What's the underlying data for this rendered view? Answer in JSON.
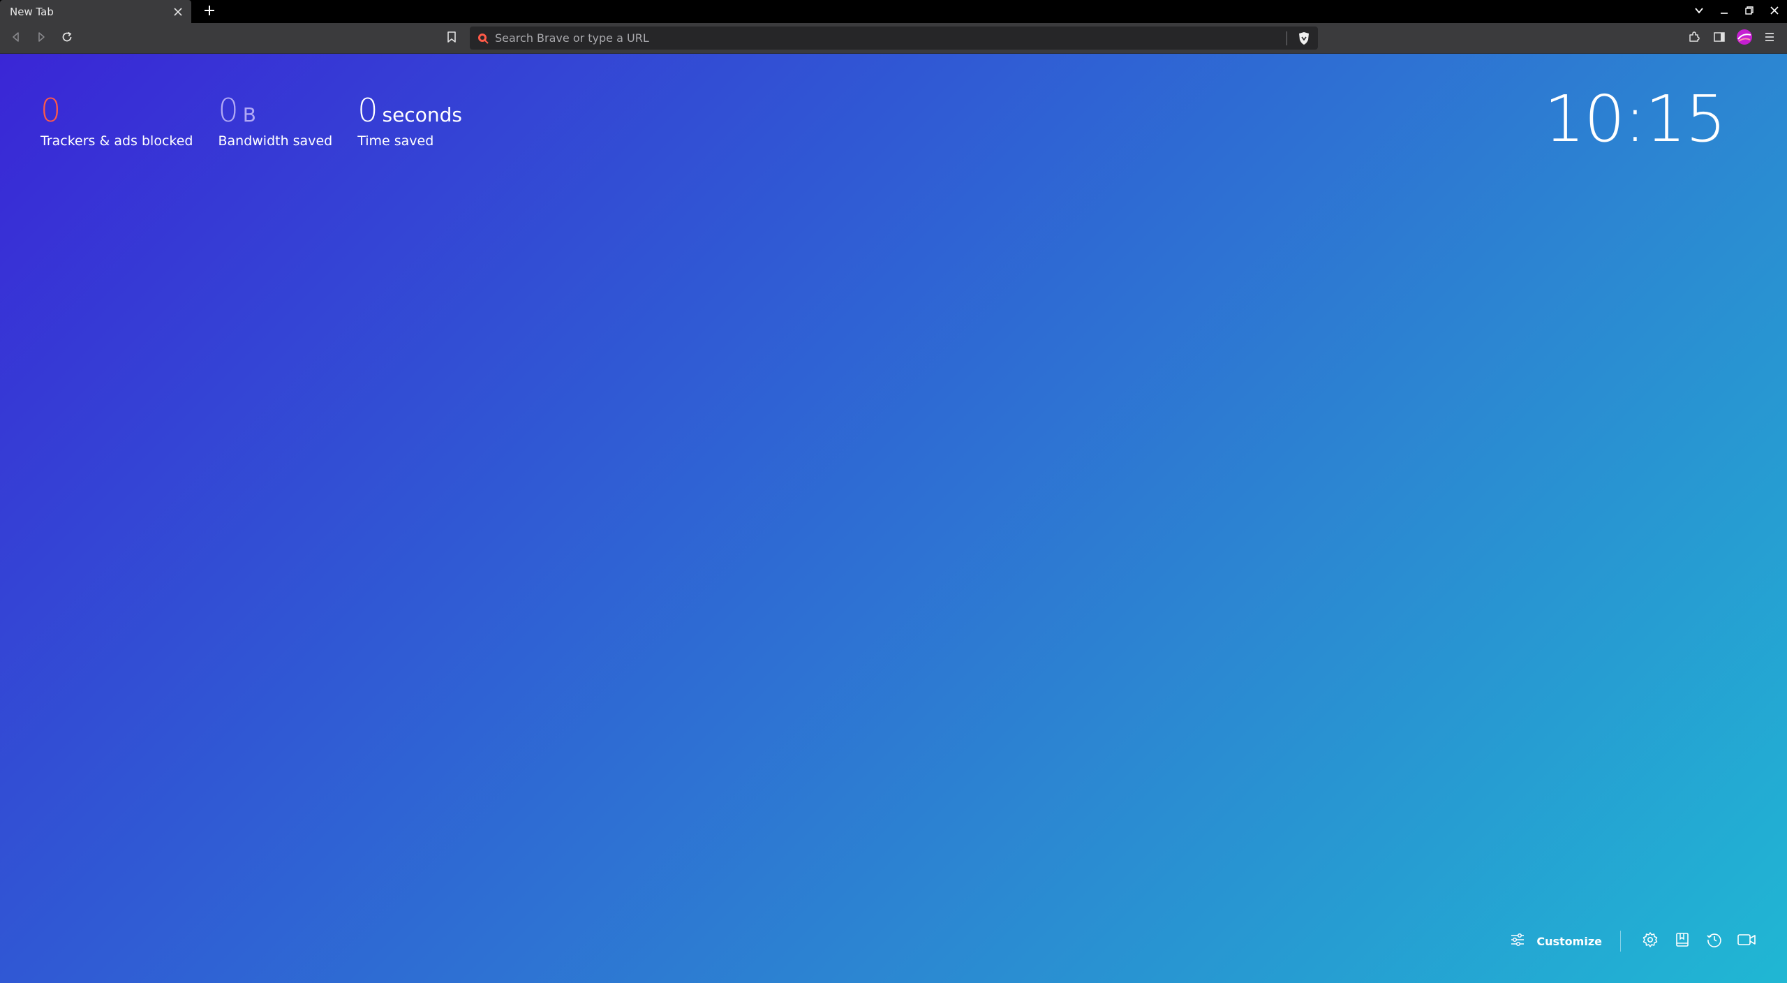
{
  "tab": {
    "title": "New Tab"
  },
  "omnibox": {
    "placeholder": "Search Brave or type a URL"
  },
  "stats": {
    "trackers": {
      "value": "0",
      "label": "Trackers & ads blocked"
    },
    "bandwidth": {
      "value": "0",
      "unit": "B",
      "label": "Bandwidth saved"
    },
    "time": {
      "value": "0",
      "unit": "seconds",
      "label": "Time saved"
    }
  },
  "clock": {
    "time": "10:15"
  },
  "footer": {
    "customize_label": "Customize"
  },
  "colors": {
    "tracker_count": "#ff5a48",
    "bandwidth_count": "#b1a9f5",
    "gradient_start": "#3a26d6",
    "gradient_end": "#20b7d3"
  },
  "icons": [
    "close-icon",
    "plus-icon",
    "chevron-down-icon",
    "minimize-icon",
    "restore-icon",
    "back-icon",
    "forward-icon",
    "reload-icon",
    "bookmark-icon",
    "search-icon",
    "brave-shield-icon",
    "extensions-icon",
    "sidebar-icon",
    "profile-avatar-icon",
    "menu-icon",
    "sliders-icon",
    "gear-icon",
    "bookmarks-icon",
    "history-icon",
    "camera-icon"
  ]
}
